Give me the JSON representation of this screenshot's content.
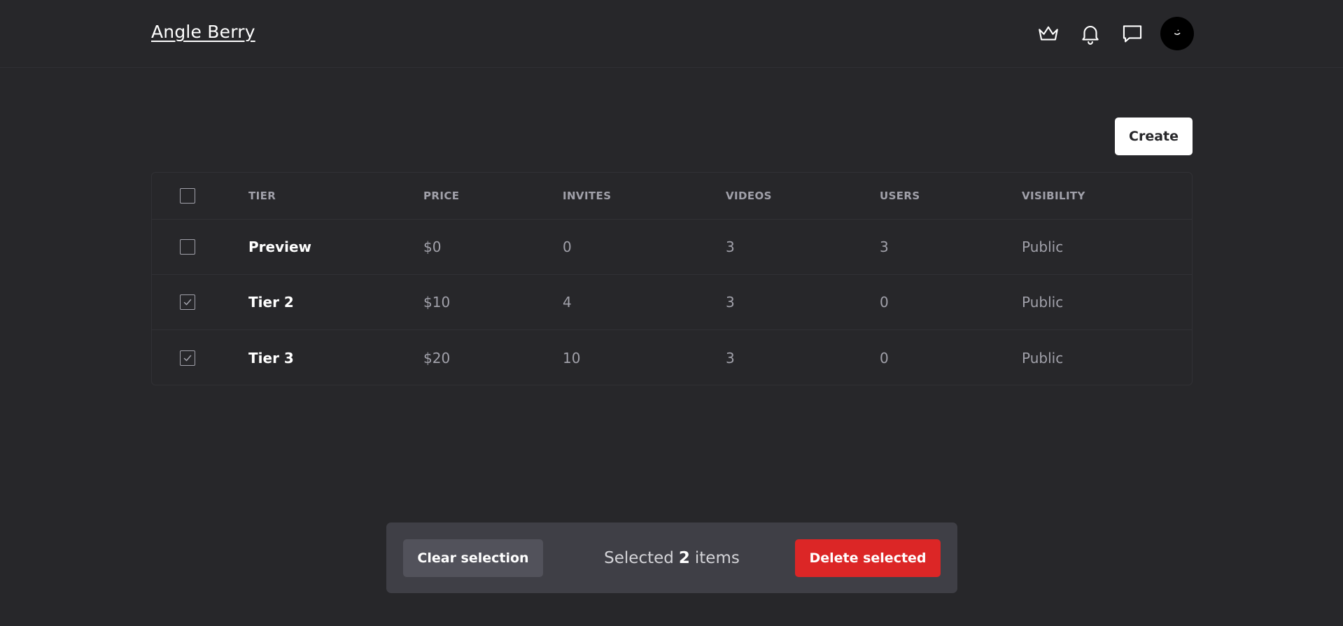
{
  "header": {
    "brand": "Angle Berry",
    "icons": [
      "crown-icon",
      "bell-icon",
      "message-icon"
    ],
    "avatar": "avatar"
  },
  "actions": {
    "create_label": "Create"
  },
  "table": {
    "columns": [
      "TIER",
      "PRICE",
      "INVITES",
      "VIDEOS",
      "USERS",
      "VISIBILITY"
    ],
    "rows": [
      {
        "checked": false,
        "tier": "Preview",
        "price": "$0",
        "invites": "0",
        "videos": "3",
        "users": "3",
        "visibility": "Public"
      },
      {
        "checked": true,
        "tier": "Tier 2",
        "price": "$10",
        "invites": "4",
        "videos": "3",
        "users": "0",
        "visibility": "Public"
      },
      {
        "checked": true,
        "tier": "Tier 3",
        "price": "$20",
        "invites": "10",
        "videos": "3",
        "users": "0",
        "visibility": "Public"
      }
    ]
  },
  "selection_bar": {
    "clear_label": "Clear selection",
    "selected_prefix": "Selected",
    "selected_count": "2",
    "selected_suffix": "items",
    "delete_label": "Delete selected"
  },
  "colors": {
    "background": "#27272a",
    "selection_bar": "#3f3f46",
    "clear_button": "#52525b",
    "danger": "#dc2626",
    "muted_text": "#a1a1aa"
  }
}
